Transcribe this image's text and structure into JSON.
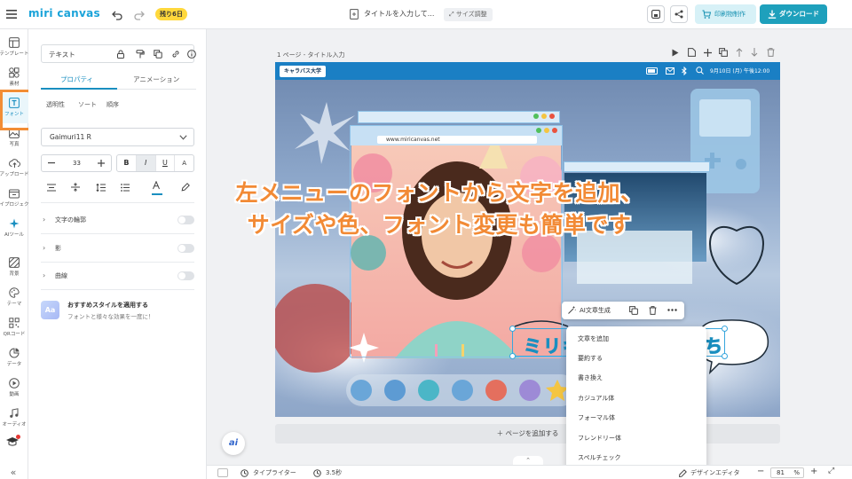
{
  "app": {
    "logo": "miri canvas",
    "trial_badge": "残り6日"
  },
  "header": {
    "doc_title": "タイトルを入力して...",
    "size_button": "サイズ調整",
    "print_button": "印刷物制作",
    "download_button": "ダウンロード"
  },
  "rail": {
    "items": [
      {
        "label": "テンプレート",
        "icon": "layout-icon"
      },
      {
        "label": "素材",
        "icon": "shapes-icon"
      },
      {
        "label": "フォント",
        "icon": "text-icon"
      },
      {
        "label": "写真",
        "icon": "image-icon"
      },
      {
        "label": "アップロード",
        "icon": "upload-icon"
      },
      {
        "label": "マイプロジェクト",
        "icon": "folder-icon"
      },
      {
        "label": "AIツール",
        "icon": "ai-tools-icon"
      },
      {
        "label": "背景",
        "icon": "background-icon"
      },
      {
        "label": "テーマ",
        "icon": "palette-icon"
      },
      {
        "label": "QRコード",
        "icon": "qr-icon"
      },
      {
        "label": "データ",
        "icon": "chart-icon"
      },
      {
        "label": "動画",
        "icon": "play-icon"
      },
      {
        "label": "オーディオ",
        "icon": "music-icon"
      }
    ]
  },
  "panel": {
    "element_type": "テキスト",
    "tabs": [
      "プロパティ",
      "アニメーション"
    ],
    "subtabs": [
      "透明性",
      "ソート",
      "順序"
    ],
    "font_name": "Gaimuri11 R",
    "font_size": "33",
    "style_buttons": [
      "B",
      "I",
      "U",
      "A"
    ],
    "options": [
      {
        "label": "文字の輪郭"
      },
      {
        "label": "影"
      },
      {
        "label": "曲線"
      }
    ],
    "recommend_title": "おすすめスタイルを適用する",
    "recommend_sub": "フォントと様々な効果を一度に！",
    "recommend_icon": "Aa"
  },
  "canvas": {
    "page_label": "1 ページ - タイトル入力",
    "artboard_logo": "キャラバス大学",
    "artboard_date": "9月10日 (月) 午後12:00",
    "browser_url": "www.miricanvas.net",
    "headline_line1": "左メニューのフォントから文字を追加、",
    "headline_line2": "サイズや色、フォント変更も簡単です",
    "selected_text": "ミリキ",
    "selected_text_right": "ち",
    "add_page": "ページを追加する",
    "accent_orange": "#f28a35",
    "accent_blue": "#1a8fc0"
  },
  "float_toolbar": {
    "ai_label": "AI文章生成"
  },
  "context_menu": {
    "items": [
      "文章を追加",
      "要約する",
      "書き換え",
      "カジュアル体",
      "フォーマル体",
      "フレンドリー体",
      "スペルチェック"
    ]
  },
  "bottom": {
    "typewriter": "タイプライター",
    "duration": "3.5秒",
    "design_editor": "デザインエディタ",
    "zoom": "81"
  },
  "fab": {
    "label": "ai"
  }
}
